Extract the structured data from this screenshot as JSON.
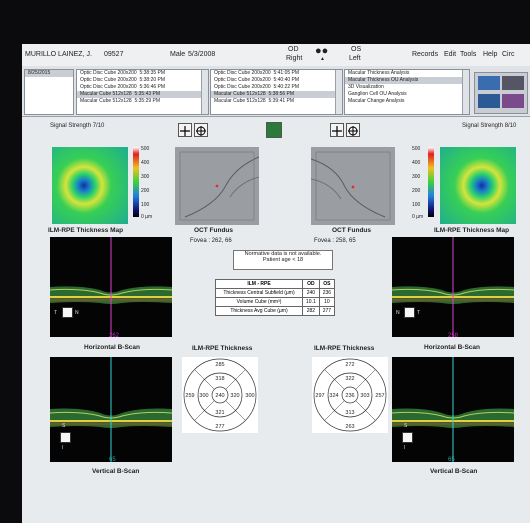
{
  "header": {
    "patient_name": "MURILLO LAINEZ, J.",
    "patient_id": "09527",
    "sex": "Male",
    "dob": "5/3/2008",
    "od_label": "OD",
    "od_side": "Right",
    "os_label": "OS",
    "os_side": "Left",
    "menu": [
      "Records",
      "Edit",
      "Tools",
      "Help",
      "Circ"
    ]
  },
  "exam_date": "8/25/2015",
  "scans_od": [
    {
      "name": "Optic Disc Cube 200x200",
      "time": "5:38:35 PM"
    },
    {
      "name": "Optic Disc Cube 200x200",
      "time": "5:38:20 PM"
    },
    {
      "name": "Optic Disc Cube 200x200",
      "time": "5:36:46 PM"
    },
    {
      "name": "Macular Cube 512x128",
      "time": "5:35:43 PM"
    },
    {
      "name": "Macular Cube 512x128",
      "time": "5:35:29 PM"
    }
  ],
  "scans_os": [
    {
      "name": "Optic Disc Cube 200x200",
      "time": "5:41:05 PM"
    },
    {
      "name": "Optic Disc Cube 200x200",
      "time": "5:40:40 PM"
    },
    {
      "name": "Optic Disc Cube 200x200",
      "time": "5:40:22 PM"
    },
    {
      "name": "Macular Cube 512x128",
      "time": "5:38:56 PM"
    },
    {
      "name": "Macular Cube 512x128",
      "time": "5:39:41 PM"
    }
  ],
  "analyses": [
    "Macular Thickness Analysis",
    "Macular Thickness OU Analysis",
    "3D Visualization",
    "Ganglion Cell OU Analysis",
    "Macular Change Analysis"
  ],
  "signal_strength_od": "Signal Strength 7/10",
  "signal_strength_os": "Signal Strength 8/10",
  "thickness_scale": [
    "500",
    "400",
    "300",
    "200",
    "100",
    "0 µm"
  ],
  "labels": {
    "ilm_map": "ILM-RPE Thickness Map",
    "oct_fundus": "OCT Fundus",
    "horizontal": "Horizontal B-Scan",
    "vertical": "Vertical B-Scan",
    "ilm_thickness": "ILM-RPE Thickness"
  },
  "fovea_od": "Fovea :  262, 66",
  "fovea_os": "Fovea :  258, 65",
  "normative_line1": "Normative data is not available.",
  "normative_line2": "Patient age < 18",
  "table": {
    "headers": [
      "ILM - RPE",
      "OD",
      "OS"
    ],
    "rows": [
      [
        "Thickness Central Subfield (µm)",
        "240",
        "236"
      ],
      [
        "Volume Cube (mm³)",
        "10.1",
        "10"
      ],
      [
        "Thickness Avg Cube (µm)",
        "282",
        "277"
      ]
    ]
  },
  "bscan_h_od": "262",
  "bscan_h_os": "258",
  "bscan_v_od": "65",
  "bscan_v_os": "65",
  "etdrs_od": {
    "outer_top": "285",
    "inner_top": "318",
    "outer_nasal": "259",
    "inner_nasal": "300",
    "center": "240",
    "inner_temporal": "320",
    "outer_temporal": "300",
    "inner_bottom": "321",
    "outer_bottom": "277"
  },
  "etdrs_os": {
    "outer_top": "272",
    "inner_top": "322",
    "outer_temporal": "297",
    "inner_temporal": "324",
    "center": "236",
    "inner_nasal": "303",
    "outer_nasal": "257",
    "inner_bottom": "313",
    "outer_bottom": "263"
  },
  "colors": {
    "od_line": "#e040d0",
    "os_line": "#35d1d6"
  }
}
